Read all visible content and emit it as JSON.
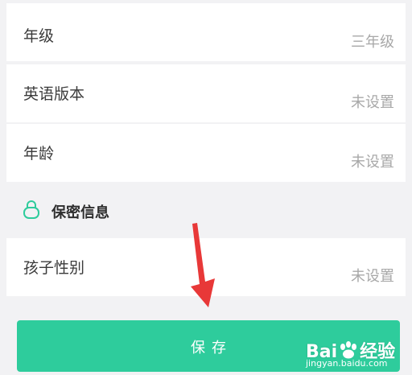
{
  "profile": {
    "rows": [
      {
        "label": "年级",
        "value": "三年级"
      },
      {
        "label": "英语版本",
        "value": "未设置"
      },
      {
        "label": "年龄",
        "value": "未设置"
      }
    ],
    "private_section": {
      "title": "保密信息",
      "icon": "lock-icon",
      "rows": [
        {
          "label": "孩子性别",
          "value": "未设置"
        }
      ]
    }
  },
  "actions": {
    "save_label": "保存"
  },
  "watermark": {
    "brand_text": "Bai",
    "brand_suffix": "经验",
    "url": "jingyan.baidu.com"
  },
  "colors": {
    "accent": "#2ecc9c",
    "arrow": "#e83838",
    "value_text": "#a8a8a8",
    "background": "#f2f2f4"
  }
}
